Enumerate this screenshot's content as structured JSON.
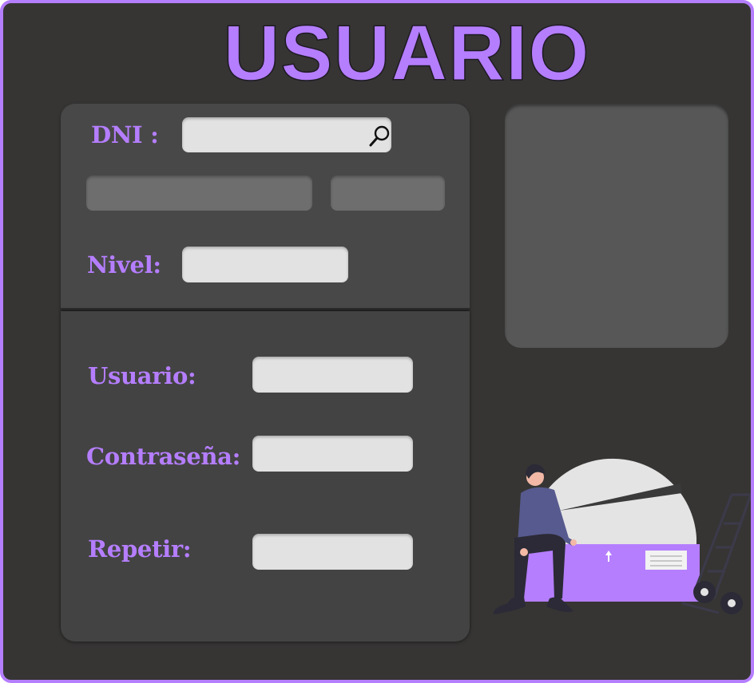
{
  "title": "USUARIO",
  "form": {
    "dni_label": "DNI :",
    "dni_value": "",
    "name_value": "",
    "code_value": "",
    "nivel_label": "Nivel:",
    "nivel_value": "",
    "usuario_label": "Usuario:",
    "usuario_value": "",
    "contrasena_label": "Contraseña:",
    "contrasena_value": "",
    "repetir_label": "Repetir:",
    "repetir_value": ""
  },
  "icons": {
    "search": "search-icon",
    "illustration": "person-sitting-on-box-illustration"
  },
  "colors": {
    "accent": "#b57eff",
    "background": "#363534",
    "panel": "#484848",
    "field": "#e2e2e2"
  }
}
